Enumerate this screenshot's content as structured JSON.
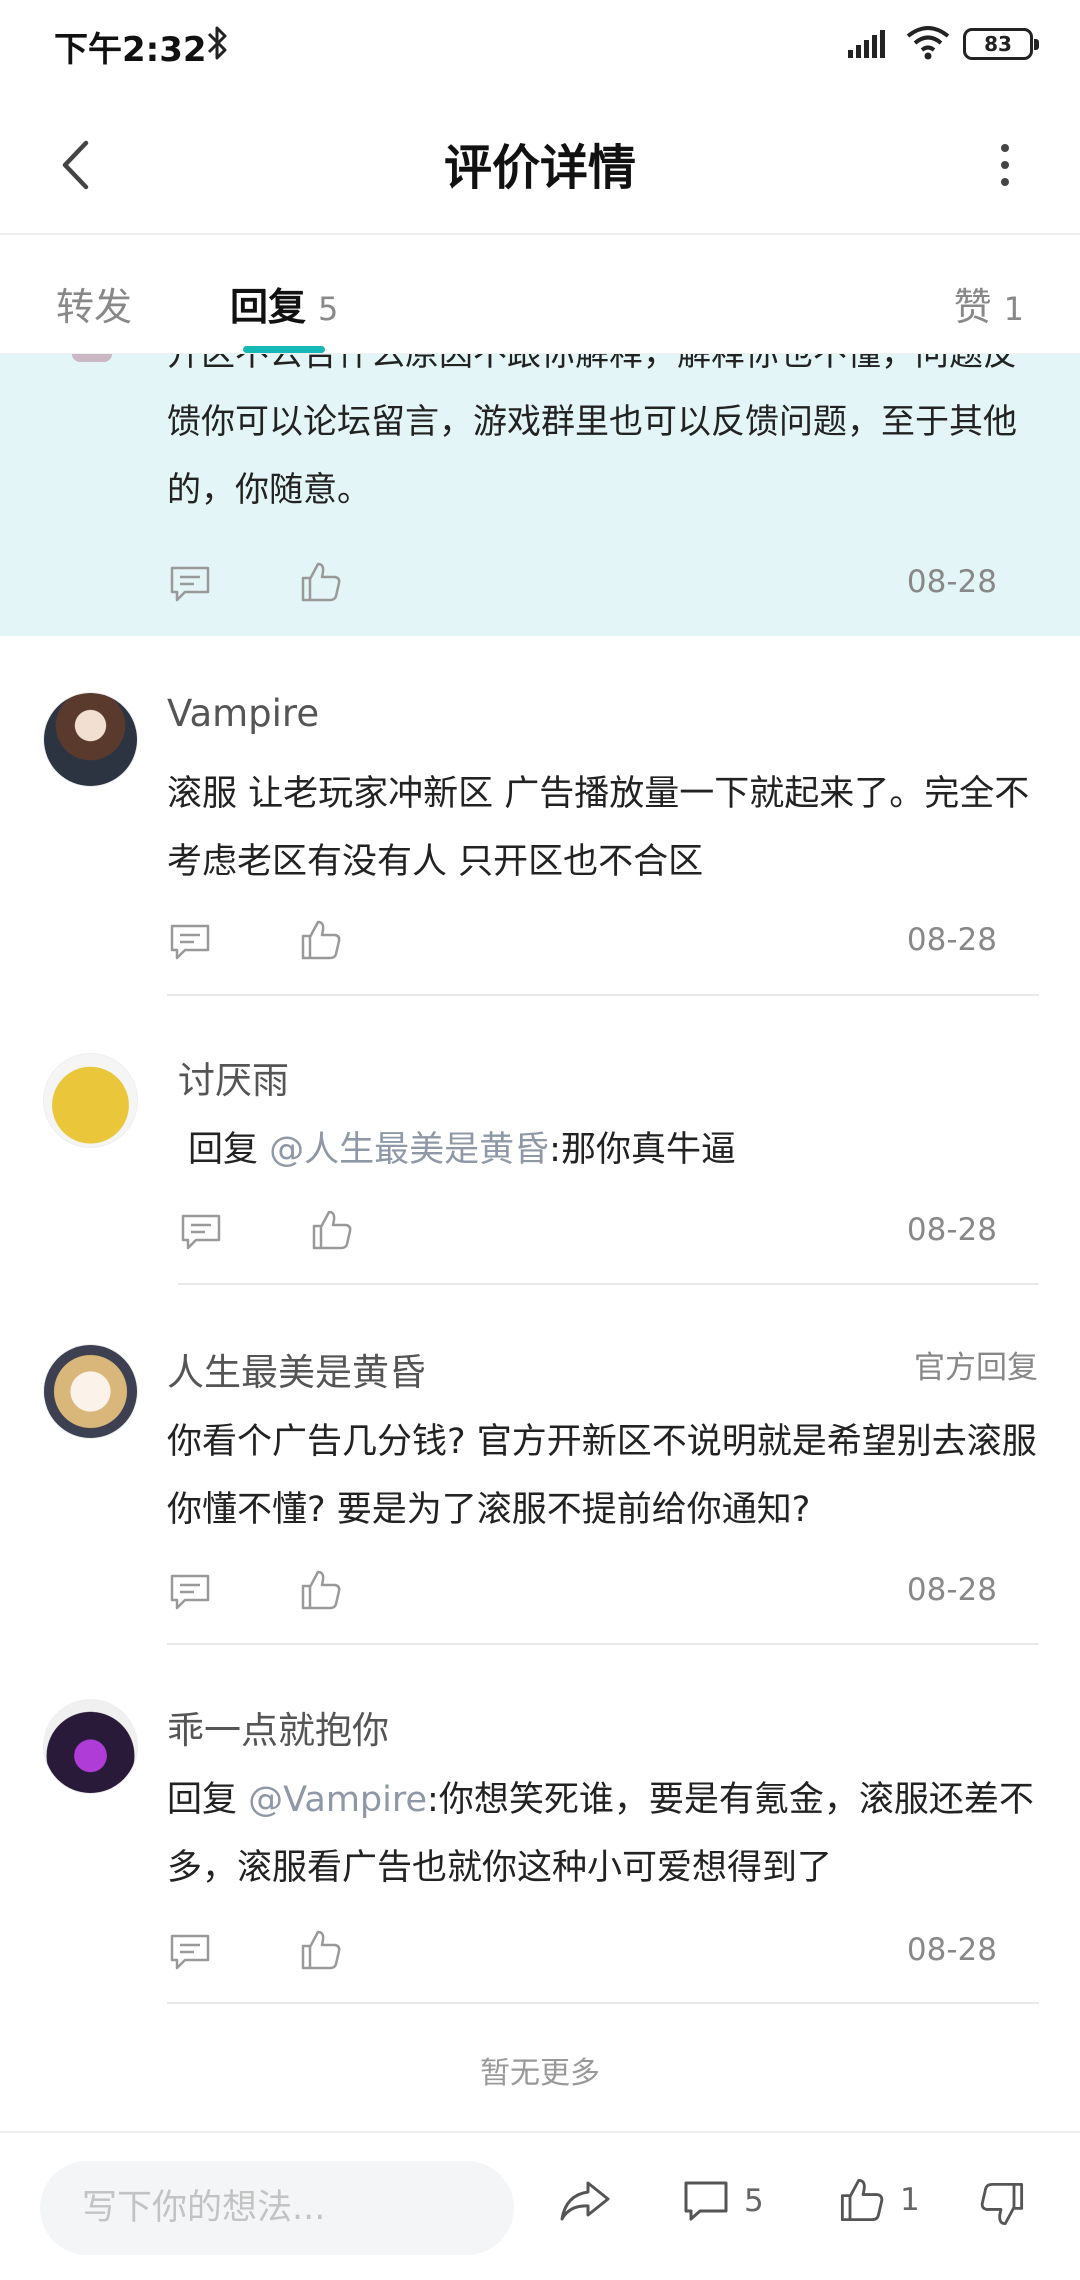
{
  "status_bar": {
    "time": "下午2:32",
    "battery": "83"
  },
  "header": {
    "title": "评价详情"
  },
  "tabs": {
    "forward": {
      "label": "转发"
    },
    "reply": {
      "label": "回复",
      "count": "5"
    },
    "like": {
      "label": "赞",
      "count": "1"
    }
  },
  "highlight_comment": {
    "text": "开区不公告什么原因不跟你解释，解释你也不懂，问题反馈你可以论坛留言，游戏群里也可以反馈问题，至于其他的，你随意。",
    "date": "08-28"
  },
  "comments": [
    {
      "username": "Vampire",
      "text": "滚服 让老玩家冲新区 广告播放量一下就起来了。完全不考虑老区有没有人 只开区也不合区",
      "date": "08-28"
    },
    {
      "username": "讨厌雨",
      "reply_prefix": "回复",
      "mention": "@人生最美是黄昏",
      "text": ":那你真牛逼",
      "date": "08-28"
    },
    {
      "username": "人生最美是黄昏",
      "official_tag": "官方回复",
      "text": "你看个广告几分钱? 官方开新区不说明就是希望别去滚服你懂不懂? 要是为了滚服不提前给你通知?",
      "date": "08-28"
    },
    {
      "username": "乖一点就抱你",
      "reply_prefix": "回复",
      "mention": "@Vampire",
      "text": ":你想笑死谁，要是有氪金，滚服还差不多，滚服看广告也就你这种小可爱想得到了",
      "date": "08-28"
    }
  ],
  "footer": {
    "no_more": "暂无更多"
  },
  "bottom_bar": {
    "input_placeholder": "写下你的想法...",
    "comment_count": "5",
    "like_count": "1"
  },
  "colors": {
    "accent": "#15b8b5",
    "highlight_bg": "#e3f5f6",
    "mention": "#8f98a6"
  }
}
